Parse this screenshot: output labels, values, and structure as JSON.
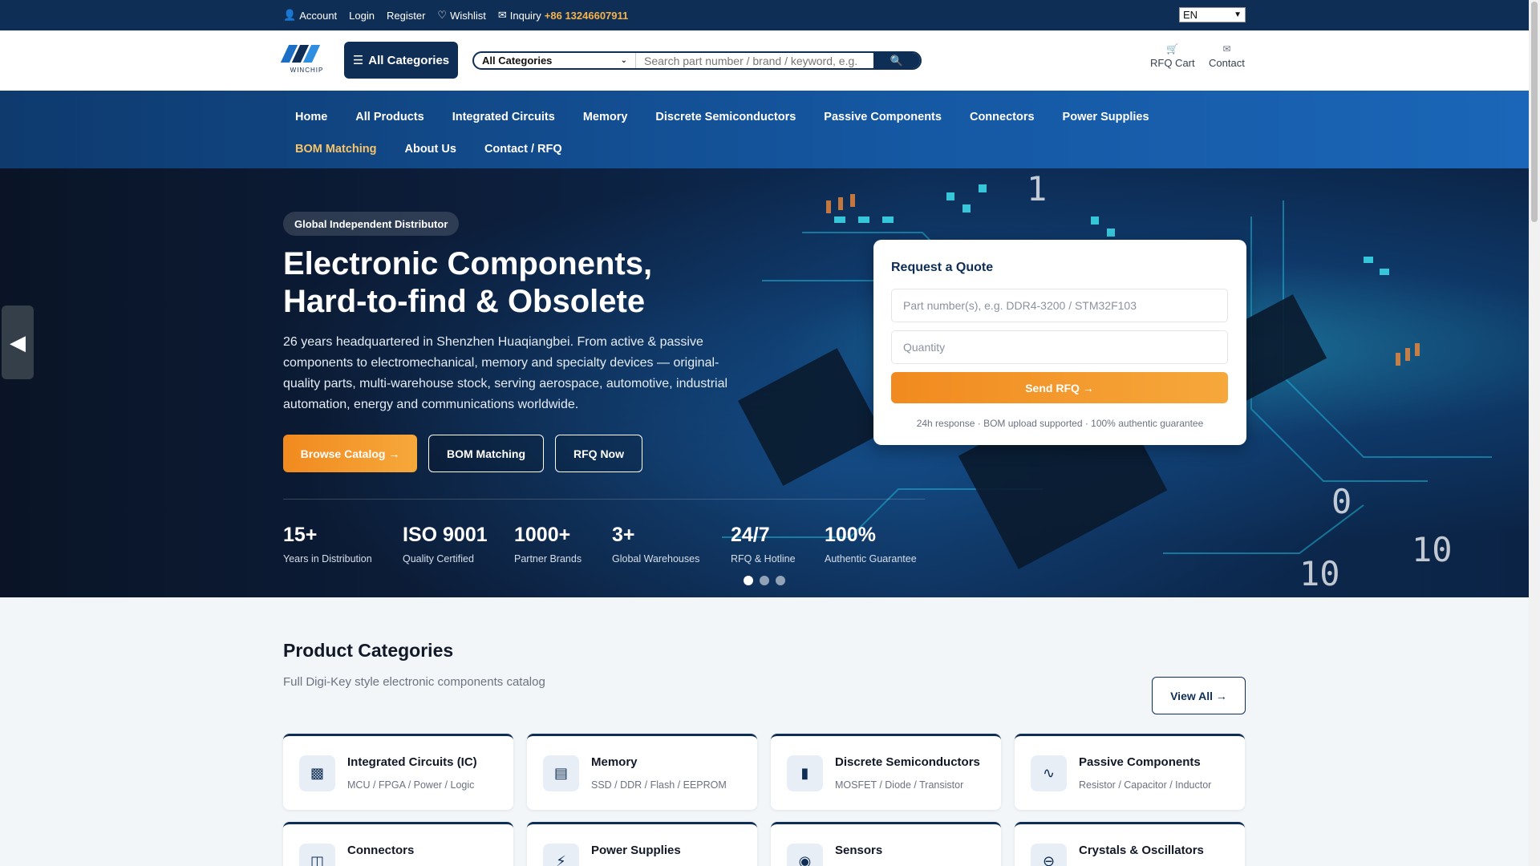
{
  "topbar": {
    "account": "Account",
    "login": "Login",
    "register": "Register",
    "wishlist": "Wishlist",
    "inquiry_label": "Inquiry",
    "phone": "+86 13246607911",
    "language": "EN"
  },
  "header": {
    "logo_text": "WINCHIP",
    "all_categories": "All Categories",
    "search_select": "All Categories",
    "search_placeholder": "Search part number / brand / keyword, e.g.",
    "rfq_cart": "RFQ Cart",
    "contact": "Contact"
  },
  "nav": {
    "row1": [
      "Home",
      "All Products",
      "Integrated Circuits",
      "Memory",
      "Discrete Semiconductors",
      "Passive Components",
      "Connectors",
      "Power Supplies"
    ],
    "row2": [
      "BOM Matching",
      "About Us",
      "Contact / RFQ"
    ],
    "active": "BOM Matching"
  },
  "hero": {
    "badge": "Global Independent Distributor",
    "title_line1": "Electronic Components,",
    "title_line2": "Hard-to-find & Obsolete",
    "description": "26 years headquartered in Shenzhen Huaqiangbei. From active & passive components to electromechanical, memory and specialty devices — original-quality parts, multi-warehouse stock, serving aerospace, automotive, industrial automation, energy and communications worldwide.",
    "btn_browse": "Browse Catalog →",
    "btn_bom": "BOM Matching",
    "btn_rfq": "RFQ Now",
    "stats": [
      {
        "value": "15+",
        "label": "Years in Distribution"
      },
      {
        "value": "ISO 9001",
        "label": "Quality Certified"
      },
      {
        "value": "1000+",
        "label": "Partner Brands"
      },
      {
        "value": "3+",
        "label": "Global Warehouses"
      },
      {
        "value": "24/7",
        "label": "RFQ & Hotline"
      },
      {
        "value": "100%",
        "label": "Authentic Guarantee"
      }
    ],
    "slide_count": 3,
    "active_slide": 1
  },
  "rfq": {
    "title": "Request a Quote",
    "part_placeholder": "Part number(s), e.g. DDR4-3200 / STM32F103",
    "qty_placeholder": "Quantity",
    "send": "Send RFQ →",
    "note": "24h response · BOM upload supported · 100% authentic guarantee"
  },
  "categories": {
    "title": "Product Categories",
    "subtitle": "Full Digi-Key style electronic components catalog",
    "view_all": "View All →",
    "items": [
      {
        "name": "Integrated Circuits (IC)",
        "sub": "MCU / FPGA / Power / Logic",
        "icon": "chip-icon"
      },
      {
        "name": "Memory",
        "sub": "SSD / DDR / Flash / EEPROM",
        "icon": "memory-icon"
      },
      {
        "name": "Discrete Semiconductors",
        "sub": "MOSFET / Diode / Transistor",
        "icon": "transistor-icon"
      },
      {
        "name": "Passive Components",
        "sub": "Resistor / Capacitor / Inductor",
        "icon": "waveform-icon"
      },
      {
        "name": "Connectors",
        "sub": "",
        "icon": "connector-icon"
      },
      {
        "name": "Power Supplies",
        "sub": "",
        "icon": "power-supply-icon"
      },
      {
        "name": "Sensors",
        "sub": "",
        "icon": "sensor-icon"
      },
      {
        "name": "Crystals & Oscillators",
        "sub": "",
        "icon": "oscillator-icon"
      }
    ]
  },
  "colors": {
    "navy": "#0f2e55",
    "accent_orange": "#f18a1f",
    "nav_active": "#f6c46a"
  }
}
